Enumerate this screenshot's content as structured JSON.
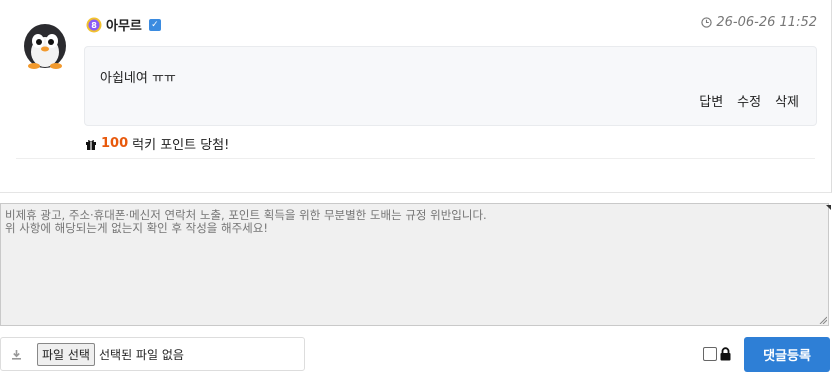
{
  "comment": {
    "level": "8",
    "username": "아무르",
    "timestamp": "26-06-26 11:52",
    "body": "아쉽네여 ㅠㅠ",
    "actions": {
      "reply": "답변",
      "edit": "수정",
      "delete": "삭제"
    },
    "lucky_points": "100",
    "lucky_text": "럭키 포인트 당첨!"
  },
  "form": {
    "placeholder": "비제휴 광고, 주소·휴대폰·메신저 연락처 노출, 포인트 획득을 위한 무분별한 도배는 규정 위반입니다.\n위 사항에 해당되는게 없는지 확인 후 작성을 해주세요!",
    "file_button": "파일 선택",
    "file_status": "선택된 파일 없음",
    "submit_label": "댓글등록"
  },
  "colors": {
    "accent": "#2e7fd6",
    "points": "#e8590c",
    "verified": "#3b8be0"
  }
}
